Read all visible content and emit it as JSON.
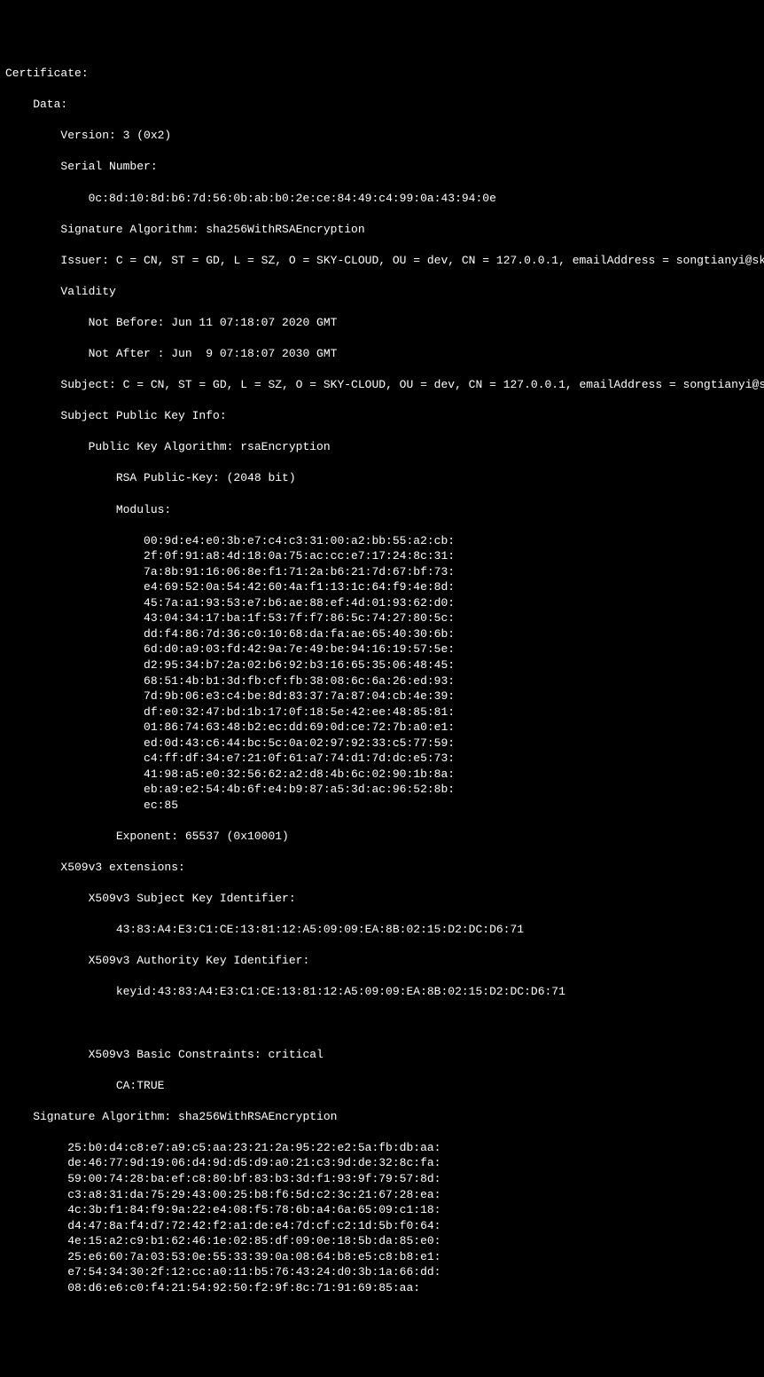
{
  "cert_label": "Certificate:",
  "data_label": "Data:",
  "version_line": "Version: 3 (0x2)",
  "serial_label": "Serial Number:",
  "serial_value": "0c:8d:10:8d:b6:7d:56:0b:ab:b0:2e:ce:84:49:c4:99:0a:43:94:0e",
  "sig_alg_line": "Signature Algorithm: sha256WithRSAEncryption",
  "issuer_line": "Issuer: C = CN, ST = GD, L = SZ, O = SKY-CLOUD, OU = dev, CN = 127.0.0.1, emailAddress = songtianyi@sky-cloud.net",
  "validity_label": "Validity",
  "not_before": "Not Before: Jun 11 07:18:07 2020 GMT",
  "not_after": "Not After : Jun  9 07:18:07 2030 GMT",
  "subject_line": "Subject: C = CN, ST = GD, L = SZ, O = SKY-CLOUD, OU = dev, CN = 127.0.0.1, emailAddress = songtianyi@sky-cloud.net",
  "spki_label": "Subject Public Key Info:",
  "pka_line": "Public Key Algorithm: rsaEncryption",
  "rsa_key_line": "RSA Public-Key: (2048 bit)",
  "modulus_label": "Modulus:",
  "modulus_lines": [
    "00:9d:e4:e0:3b:e7:c4:c3:31:00:a2:bb:55:a2:cb:",
    "2f:0f:91:a8:4d:18:0a:75:ac:cc:e7:17:24:8c:31:",
    "7a:8b:91:16:06:8e:f1:71:2a:b6:21:7d:67:bf:73:",
    "e4:69:52:0a:54:42:60:4a:f1:13:1c:64:f9:4e:8d:",
    "45:7a:a1:93:53:e7:b6:ae:88:ef:4d:01:93:62:d0:",
    "43:04:34:17:ba:1f:53:7f:f7:86:5c:74:27:80:5c:",
    "dd:f4:86:7d:36:c0:10:68:da:fa:ae:65:40:30:6b:",
    "6d:d0:a9:03:fd:42:9a:7e:49:be:94:16:19:57:5e:",
    "d2:95:34:b7:2a:02:b6:92:b3:16:65:35:06:48:45:",
    "68:51:4b:b1:3d:fb:cf:fb:38:08:6c:6a:26:ed:93:",
    "7d:9b:06:e3:c4:be:8d:83:37:7a:87:04:cb:4e:39:",
    "df:e0:32:47:bd:1b:17:0f:18:5e:42:ee:48:85:81:",
    "01:86:74:63:48:b2:ec:dd:69:0d:ce:72:7b:a0:e1:",
    "ed:0d:43:c6:44:bc:5c:0a:02:97:92:33:c5:77:59:",
    "c4:ff:df:34:e7:21:0f:61:a7:74:d1:7d:dc:e5:73:",
    "41:98:a5:e0:32:56:62:a2:d8:4b:6c:02:90:1b:8a:",
    "eb:a9:e2:54:4b:6f:e4:b9:87:a5:3d:ac:96:52:8b:",
    "ec:85"
  ],
  "exponent_line": "Exponent: 65537 (0x10001)",
  "x509_ext_label": "X509v3 extensions:",
  "ski_label": "X509v3 Subject Key Identifier:",
  "ski_value": "43:83:A4:E3:C1:CE:13:81:12:A5:09:09:EA:8B:02:15:D2:DC:D6:71",
  "aki_label": "X509v3 Authority Key Identifier:",
  "aki_value": "keyid:43:83:A4:E3:C1:CE:13:81:12:A5:09:09:EA:8B:02:15:D2:DC:D6:71",
  "bc_label": "X509v3 Basic Constraints: critical",
  "bc_value": "CA:TRUE",
  "sig_alg_line2": "Signature Algorithm: sha256WithRSAEncryption",
  "sig_lines": [
    "25:b0:d4:c8:e7:a9:c5:aa:23:21:2a:95:22:e2:5a:fb:db:aa:",
    "de:46:77:9d:19:06:d4:9d:d5:d9:a0:21:c3:9d:de:32:8c:fa:",
    "59:00:74:28:ba:ef:c8:80:bf:83:b3:3d:f1:93:9f:79:57:8d:",
    "c3:a8:31:da:75:29:43:00:25:b8:f6:5d:c2:3c:21:67:28:ea:",
    "4c:3b:f1:84:f9:9a:22:e4:08:f5:78:6b:a4:6a:65:09:c1:18:",
    "d4:47:8a:f4:d7:72:42:f2:a1:de:e4:7d:cf:c2:1d:5b:f0:64:",
    "4e:15:a2:c9:b1:62:46:1e:02:85:df:09:0e:18:5b:da:85:e0:",
    "25:e6:60:7a:03:53:0e:55:33:39:0a:08:64:b8:e5:c8:b8:e1:",
    "e7:54:34:30:2f:12:cc:a0:11:b5:76:43:24:d0:3b:1a:66:dd:",
    "08:d6:e6:c0:f4:21:54:92:50:f2:9f:8c:71:91:69:85:aa:"
  ]
}
